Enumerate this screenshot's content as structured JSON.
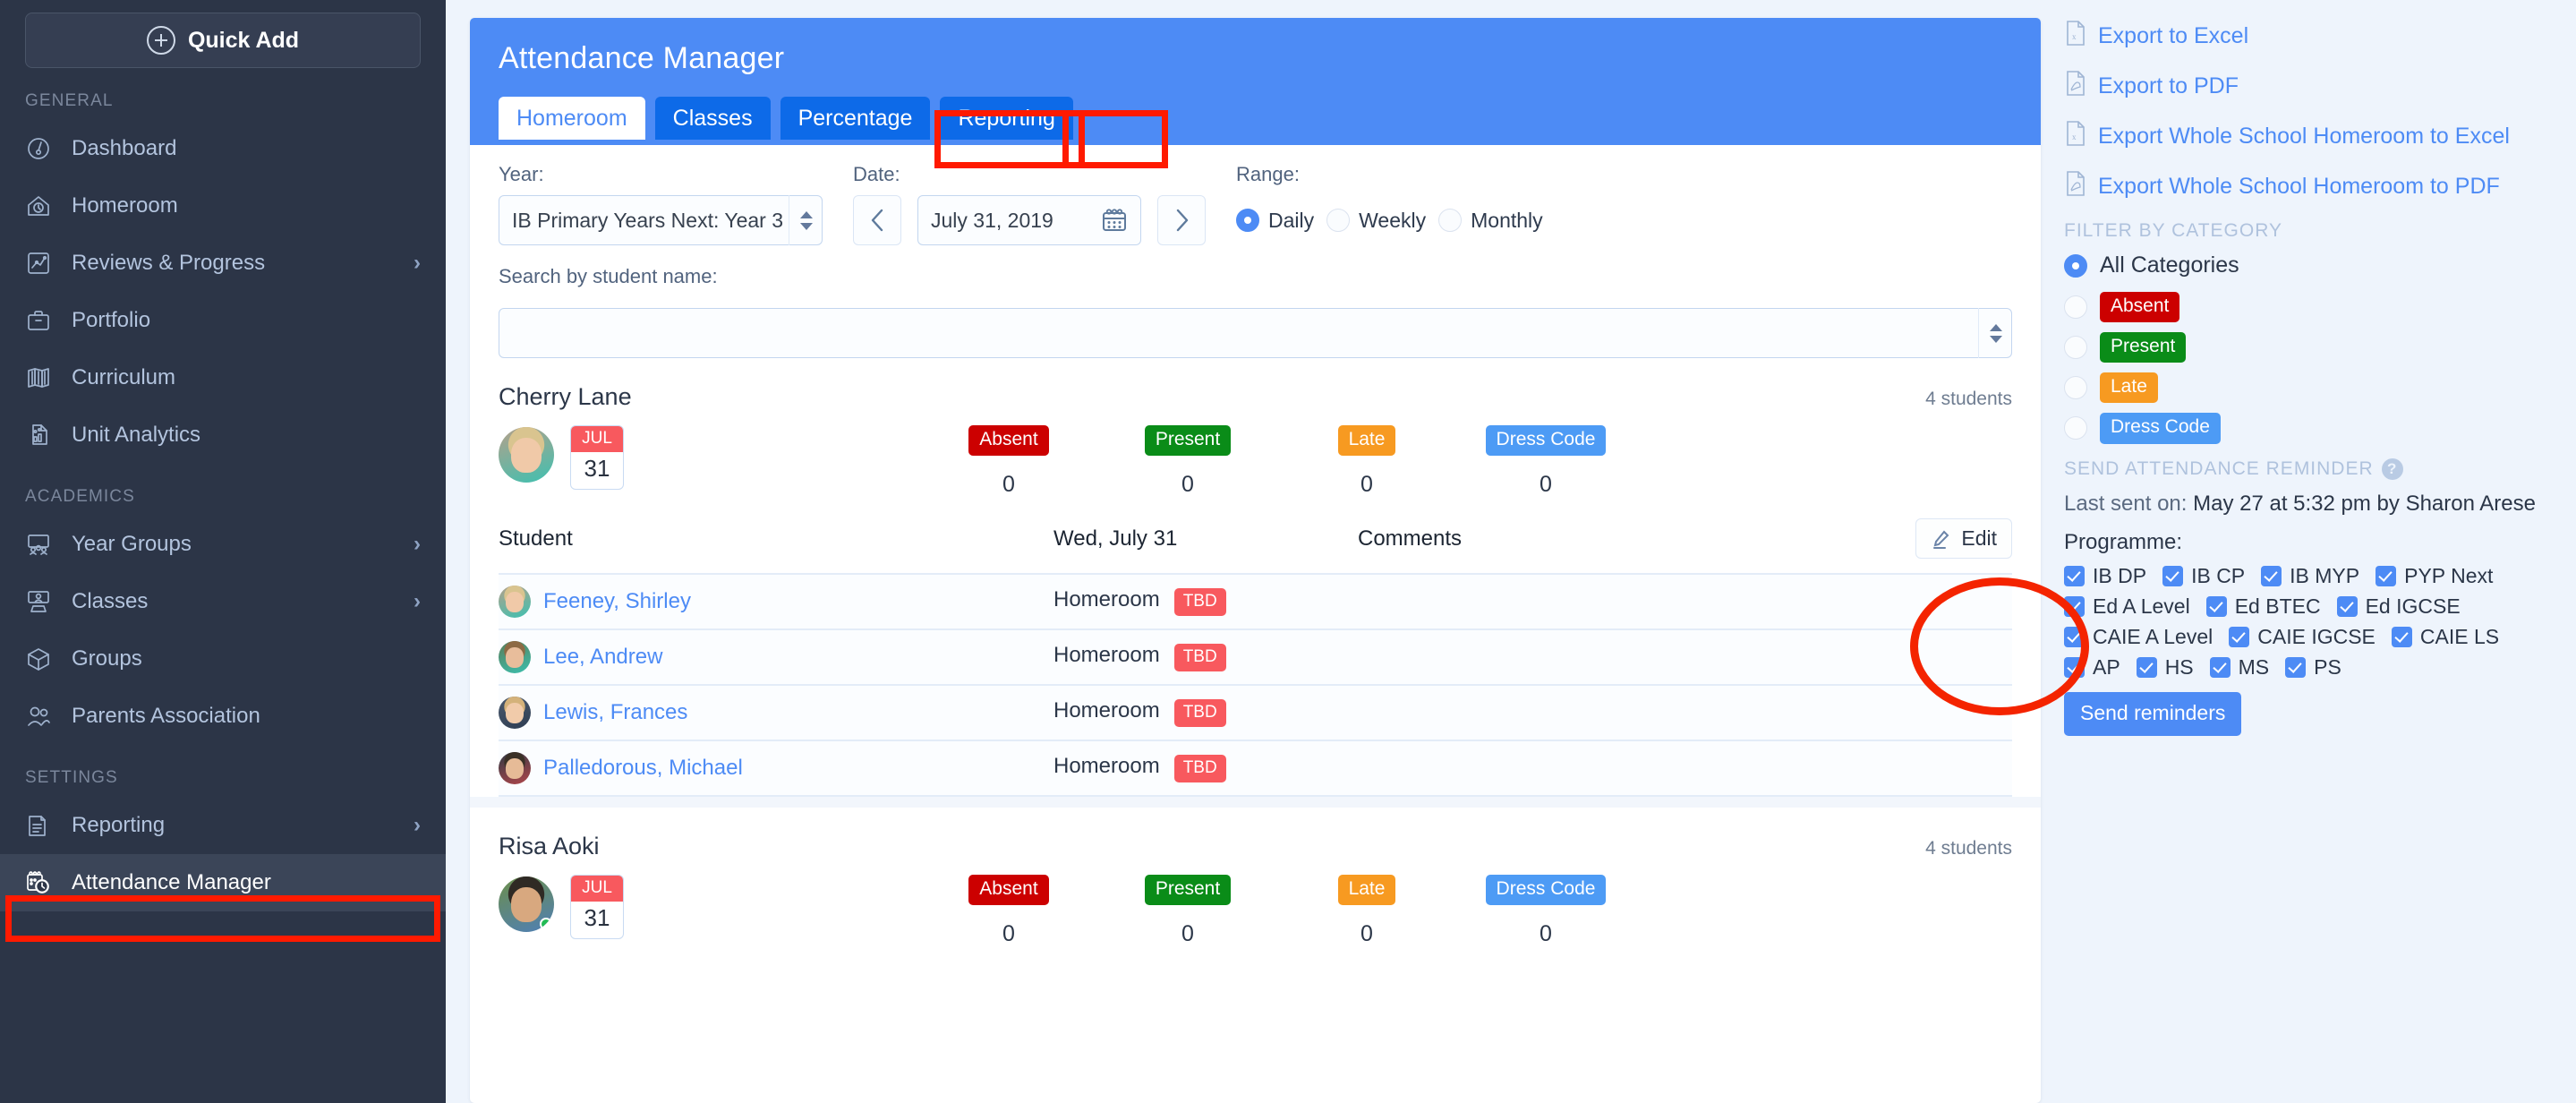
{
  "sidebar": {
    "quick_add": "Quick Add",
    "sections": [
      {
        "title": "GENERAL",
        "items": [
          {
            "label": "Dashboard",
            "icon": "gauge-icon",
            "chevron": false,
            "active": false
          },
          {
            "label": "Homeroom",
            "icon": "home-clock-icon",
            "chevron": false,
            "active": false
          },
          {
            "label": "Reviews & Progress",
            "icon": "chart-square-icon",
            "chevron": true,
            "active": false
          },
          {
            "label": "Portfolio",
            "icon": "briefcase-icon",
            "chevron": false,
            "active": false
          },
          {
            "label": "Curriculum",
            "icon": "map-book-icon",
            "chevron": false,
            "active": false
          },
          {
            "label": "Unit Analytics",
            "icon": "document-chart-icon",
            "chevron": false,
            "active": false
          }
        ]
      },
      {
        "title": "ACADEMICS",
        "items": [
          {
            "label": "Year Groups",
            "icon": "group-board-icon",
            "chevron": true,
            "active": false
          },
          {
            "label": "Classes",
            "icon": "teacher-board-icon",
            "chevron": true,
            "active": false
          },
          {
            "label": "Groups",
            "icon": "cube-icon",
            "chevron": false,
            "active": false
          },
          {
            "label": "Parents Association",
            "icon": "people-icon",
            "chevron": false,
            "active": false
          }
        ]
      },
      {
        "title": "SETTINGS",
        "items": [
          {
            "label": "Reporting",
            "icon": "report-docs-icon",
            "chevron": true,
            "active": false
          },
          {
            "label": "Attendance Manager",
            "icon": "calendar-clock-icon",
            "chevron": false,
            "active": true
          }
        ]
      }
    ]
  },
  "header": {
    "title": "Attendance Manager",
    "tabs": [
      {
        "label": "Homeroom",
        "active": true
      },
      {
        "label": "Classes",
        "active": false
      },
      {
        "label": "Percentage",
        "active": false
      },
      {
        "label": "Reporting",
        "active": false
      }
    ]
  },
  "filters": {
    "year_label": "Year:",
    "year_value": "IB Primary Years Next: Year 3",
    "date_label": "Date:",
    "date_value": "July 31, 2019",
    "prev_arrow": "‹",
    "next_arrow": "›",
    "range_label": "Range:",
    "range_options": [
      {
        "label": "Daily",
        "selected": true
      },
      {
        "label": "Weekly",
        "selected": false
      },
      {
        "label": "Monthly",
        "selected": false
      }
    ],
    "search_label": "Search by student name:",
    "search_value": "",
    "search_placeholder": ""
  },
  "table_headers": {
    "student": "Student",
    "date_column": "Wed, July 31",
    "comments": "Comments",
    "edit": "Edit"
  },
  "homerooms": [
    {
      "name": "Cherry Lane",
      "student_count": "4 students",
      "cal_month": "JUL",
      "cal_day": "31",
      "online": false,
      "stats": [
        {
          "label": "Absent",
          "kind": "absent",
          "value": "0"
        },
        {
          "label": "Present",
          "kind": "present",
          "value": "0"
        },
        {
          "label": "Late",
          "kind": "late",
          "value": "0"
        },
        {
          "label": "Dress Code",
          "kind": "dress",
          "value": "0"
        }
      ],
      "students": [
        {
          "name": "Feeney, Shirley",
          "status": "Homeroom",
          "badge": "TBD",
          "comment": ""
        },
        {
          "name": "Lee, Andrew",
          "status": "Homeroom",
          "badge": "TBD",
          "comment": ""
        },
        {
          "name": "Lewis, Frances",
          "status": "Homeroom",
          "badge": "TBD",
          "comment": ""
        },
        {
          "name": "Palledorous, Michael",
          "status": "Homeroom",
          "badge": "TBD",
          "comment": ""
        }
      ]
    },
    {
      "name": "Risa Aoki",
      "student_count": "4 students",
      "cal_month": "JUL",
      "cal_day": "31",
      "online": true,
      "stats": [
        {
          "label": "Absent",
          "kind": "absent",
          "value": "0"
        },
        {
          "label": "Present",
          "kind": "present",
          "value": "0"
        },
        {
          "label": "Late",
          "kind": "late",
          "value": "0"
        },
        {
          "label": "Dress Code",
          "kind": "dress",
          "value": "0"
        }
      ],
      "students": []
    }
  ],
  "right_panel": {
    "exports": [
      {
        "label": "Export to Excel",
        "icon": "excel-file-icon"
      },
      {
        "label": "Export to PDF",
        "icon": "pdf-file-icon"
      },
      {
        "label": "Export Whole School Homeroom to Excel",
        "icon": "excel-file-icon"
      },
      {
        "label": "Export Whole School Homeroom to PDF",
        "icon": "pdf-file-icon"
      }
    ],
    "filter_title": "FILTER BY CATEGORY",
    "all_categories": "All Categories",
    "categories": [
      {
        "label": "Absent",
        "kind": "absent",
        "selected": false
      },
      {
        "label": "Present",
        "kind": "present",
        "selected": false
      },
      {
        "label": "Late",
        "kind": "late",
        "selected": false
      },
      {
        "label": "Dress Code",
        "kind": "dress",
        "selected": false
      }
    ],
    "reminder_title": "SEND ATTENDANCE REMINDER",
    "help_glyph": "?",
    "last_sent_label": "Last sent on:",
    "last_sent_value": "May 27 at 5:32 pm by Sharon Arese",
    "programme_label": "Programme:",
    "programmes": [
      {
        "label": "IB DP",
        "checked": true
      },
      {
        "label": "IB CP",
        "checked": true
      },
      {
        "label": "IB MYP",
        "checked": true
      },
      {
        "label": "PYP Next",
        "checked": true
      },
      {
        "label": "Ed A Level",
        "checked": true
      },
      {
        "label": "Ed BTEC",
        "checked": true
      },
      {
        "label": "Ed IGCSE",
        "checked": true
      },
      {
        "label": "CAIE A Level",
        "checked": true
      },
      {
        "label": "CAIE IGCSE",
        "checked": true
      },
      {
        "label": "CAIE LS",
        "checked": true
      },
      {
        "label": "AP",
        "checked": true
      },
      {
        "label": "HS",
        "checked": true
      },
      {
        "label": "MS",
        "checked": true
      },
      {
        "label": "PS",
        "checked": true
      }
    ],
    "send_button": "Send reminders"
  },
  "colors": {
    "accent_blue": "#4d8bf5",
    "tab_blue": "#0d6ae8",
    "sidebar_bg": "#2c3547",
    "absent_red": "#cc0000",
    "present_green": "#0a8c18",
    "late_orange": "#f79a21",
    "dress_blue": "#4d9bf5",
    "tbd_red": "#f8595e",
    "annotation_red": "#f42400"
  }
}
